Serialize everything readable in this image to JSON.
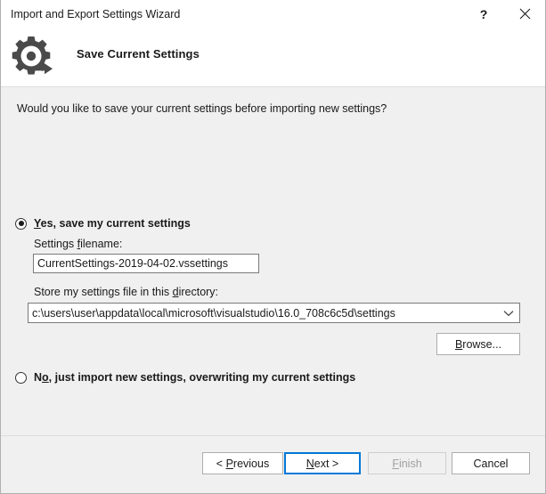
{
  "window": {
    "title": "Import and Export Settings Wizard",
    "help_icon": "question-mark-icon",
    "close_icon": "close-icon"
  },
  "header": {
    "icon": "gear-arrow-icon",
    "title": "Save Current Settings"
  },
  "body": {
    "question": "Would you like to save your current settings before importing new settings?",
    "option_yes": {
      "label_prefix": "",
      "accelerator": "Y",
      "label_rest": "es, save my current settings",
      "selected": true
    },
    "option_no": {
      "label_prefix": "N",
      "accelerator": "o",
      "label_rest": ", just import new settings, overwriting my current settings",
      "selected": false
    },
    "filename_label": {
      "prefix": "Settings ",
      "accelerator": "f",
      "rest": "ilename:"
    },
    "filename_value": "CurrentSettings-2019-04-02.vssettings",
    "filename_placeholder": "Settings filename",
    "directory_label": {
      "prefix": "Store my settings file in this ",
      "accelerator": "d",
      "rest": "irectory:"
    },
    "directory_value": "c:\\users\\user\\appdata\\local\\microsoft\\visualstudio\\16.0_708c6c5d\\settings",
    "dropdown_icon": "chevron-down-icon",
    "browse_button": {
      "prefix": "",
      "accelerator": "B",
      "rest": "rowse..."
    }
  },
  "footer": {
    "previous_button": {
      "prefix": "< ",
      "accelerator": "P",
      "rest": "revious",
      "enabled": true
    },
    "next_button": {
      "prefix": "",
      "accelerator": "N",
      "rest": "ext >",
      "enabled": true,
      "is_default": true
    },
    "finish_button": {
      "prefix": "",
      "accelerator": "F",
      "rest": "inish",
      "enabled": false
    },
    "cancel_button": {
      "prefix": "",
      "accelerator": "",
      "rest": "Cancel",
      "enabled": true
    }
  },
  "colors": {
    "dialog_background": "#f0f0f0",
    "header_background": "#ffffff",
    "accent_focus": "#0078d7",
    "text": "#1a1a1a",
    "disabled_text": "#a0a0a0",
    "input_border": "#7a7a7a",
    "button_border": "#adadad"
  }
}
